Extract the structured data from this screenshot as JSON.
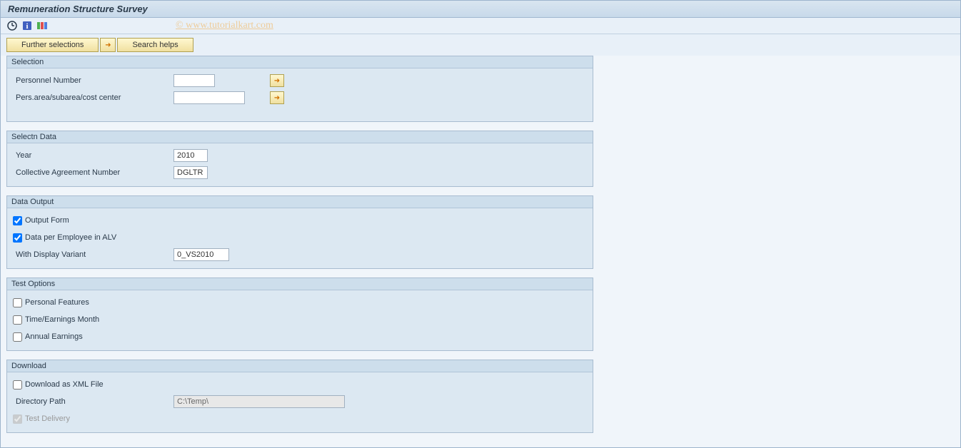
{
  "title": "Remuneration Structure Survey",
  "watermark": "© www.tutorialkart.com",
  "buttons": {
    "further_selections": "Further selections",
    "search_helps": "Search helps"
  },
  "groups": {
    "selection": {
      "title": "Selection",
      "personnel_number_label": "Personnel Number",
      "personnel_number_value": "",
      "pers_area_label": "Pers.area/subarea/cost center",
      "pers_area_value": ""
    },
    "selectn_data": {
      "title": "Selectn Data",
      "year_label": "Year",
      "year_value": "2010",
      "collective_agreement_label": "Collective Agreement Number",
      "collective_agreement_value": "DGLTR"
    },
    "data_output": {
      "title": "Data Output",
      "output_form_label": "Output Form",
      "output_form_checked": true,
      "data_per_employee_label": "Data per Employee in ALV",
      "data_per_employee_checked": true,
      "display_variant_label": "With Display Variant",
      "display_variant_value": "0_VS2010"
    },
    "test_options": {
      "title": "Test Options",
      "personal_features_label": "Personal Features",
      "personal_features_checked": false,
      "time_earnings_label": "Time/Earnings Month",
      "time_earnings_checked": false,
      "annual_earnings_label": "Annual Earnings",
      "annual_earnings_checked": false
    },
    "download": {
      "title": "Download",
      "download_xml_label": "Download as XML File",
      "download_xml_checked": false,
      "directory_path_label": "Directory Path",
      "directory_path_value": "C:\\Temp\\",
      "test_delivery_label": "Test Delivery",
      "test_delivery_checked": true
    }
  }
}
